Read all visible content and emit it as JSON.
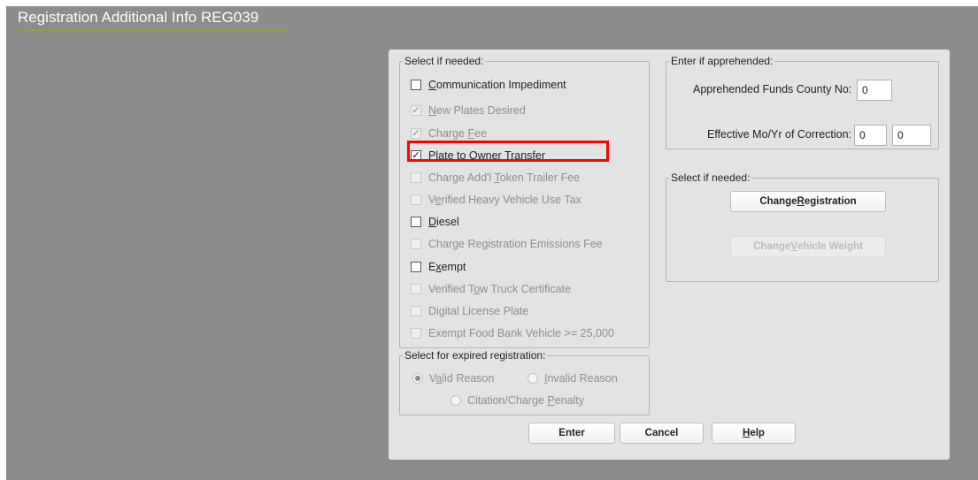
{
  "page": {
    "title": "Registration Additional Info REG039"
  },
  "options_group": {
    "legend": "Select if needed:",
    "items": [
      {
        "pre": "",
        "key": "C",
        "post": "ommunication Impediment",
        "checked": false,
        "enabled": true
      },
      {
        "pre": "",
        "key": "N",
        "post": "ew Plates Desired",
        "checked": true,
        "enabled": false
      },
      {
        "pre": "Charge ",
        "key": "F",
        "post": "ee",
        "checked": true,
        "enabled": false
      },
      {
        "pre": "Pla",
        "key": "t",
        "post": "e to Owner Transfer",
        "checked": true,
        "enabled": true
      },
      {
        "pre": "Charge Add'l ",
        "key": "T",
        "post": "oken Trailer Fee",
        "checked": false,
        "enabled": false
      },
      {
        "pre": "V",
        "key": "e",
        "post": "rified Heavy Vehicle Use Tax",
        "checked": false,
        "enabled": false
      },
      {
        "pre": "",
        "key": "D",
        "post": "iesel",
        "checked": false,
        "enabled": true
      },
      {
        "pre": "Charge Registration Emissions Fee",
        "key": "",
        "post": "",
        "checked": false,
        "enabled": false
      },
      {
        "pre": "E",
        "key": "x",
        "post": "empt",
        "checked": false,
        "enabled": true
      },
      {
        "pre": "Verified T",
        "key": "o",
        "post": "w Truck Certificate",
        "checked": false,
        "enabled": false
      },
      {
        "pre": "Digital License Plate",
        "key": "",
        "post": "",
        "checked": false,
        "enabled": false
      },
      {
        "pre": "Exempt Food Bank Vehicle >= 25,000",
        "key": "",
        "post": "",
        "checked": false,
        "enabled": false
      }
    ]
  },
  "expired_group": {
    "legend": "Select for expired registration:",
    "valid": {
      "pre": "V",
      "key": "a",
      "post": "lid Reason",
      "selected": true
    },
    "invalid": {
      "pre": "",
      "key": "I",
      "post": "nvalid Reason",
      "selected": false
    },
    "citation": {
      "pre": "Citation/Charge ",
      "key": "P",
      "post": "enalty",
      "selected": false
    }
  },
  "apprehended_group": {
    "legend": "Enter if apprehended:",
    "county_label": "Apprehended Funds County No:",
    "county_value": "0",
    "correction_label": "Effective Mo/Yr of Correction:",
    "month_value": "0",
    "year_value": "0"
  },
  "actions_group": {
    "legend": "Select if needed:",
    "change_registration": {
      "pre": "Change ",
      "key": "R",
      "post": "egistration",
      "enabled": true
    },
    "change_weight": {
      "pre": "Change ",
      "key": "V",
      "post": "ehicle Weight",
      "enabled": false
    }
  },
  "footer": {
    "enter": {
      "pre": "Enter",
      "key": "",
      "post": ""
    },
    "cancel": {
      "pre": "Cancel",
      "key": "",
      "post": ""
    },
    "help": {
      "pre": "",
      "key": "H",
      "post": "elp"
    }
  }
}
